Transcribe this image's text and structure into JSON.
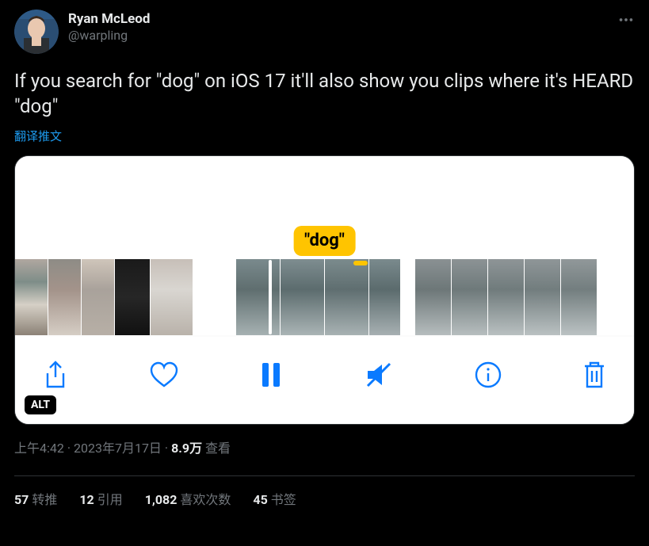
{
  "author": {
    "display_name": "Ryan McLeod",
    "handle": "@warpling"
  },
  "tweet_text": "If you search for \"dog\" on iOS 17 it'll also show you clips where it's HEARD \"dog\"",
  "translate": "翻译推文",
  "media": {
    "bubble_text": "\"dog\"",
    "alt_badge": "ALT"
  },
  "meta": {
    "time": "上午4:42",
    "separator": " · ",
    "date": "2023年7月17日",
    "views_num": "8.9万",
    "views_label": " 查看"
  },
  "stats": {
    "retweets_num": "57",
    "retweets_label": "转推",
    "quotes_num": "12",
    "quotes_label": "引用",
    "likes_num": "1,082",
    "likes_label": "喜欢次数",
    "bookmarks_num": "45",
    "bookmarks_label": "书签"
  }
}
